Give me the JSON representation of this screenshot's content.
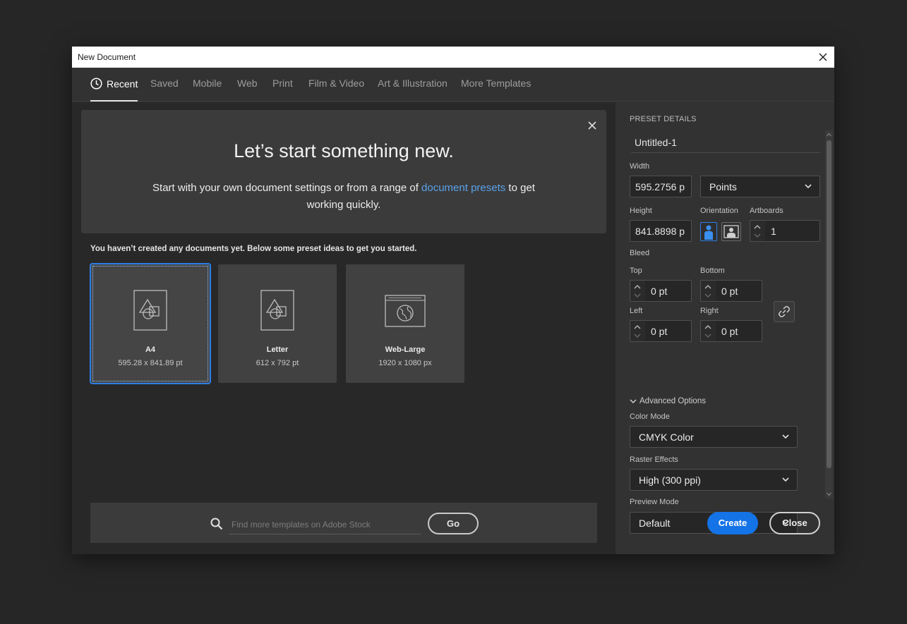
{
  "window": {
    "title": "New Document",
    "close_icon": "close-icon"
  },
  "tabs": [
    {
      "label": "Recent",
      "active": true,
      "icon": "clock-icon"
    },
    {
      "label": "Saved"
    },
    {
      "label": "Mobile"
    },
    {
      "label": "Web"
    },
    {
      "label": "Print"
    },
    {
      "label": "Film & Video"
    },
    {
      "label": "Art & Illustration"
    },
    {
      "label": "More Templates"
    }
  ],
  "hero": {
    "title": "Let’s start something new.",
    "text_before": "Start with your own document settings or from a range of ",
    "link": "document presets",
    "text_after": " to get working quickly."
  },
  "hint": "You haven’t created any documents yet. Below some preset ideas to get you started.",
  "presets": [
    {
      "name": "A4",
      "size": "595.28 x 841.89 pt",
      "selected": true,
      "icon": "page-shapes-icon"
    },
    {
      "name": "Letter",
      "size": "612 x 792 pt",
      "icon": "page-shapes-icon"
    },
    {
      "name": "Web-Large",
      "size": "1920 x 1080 px",
      "icon": "web-globe-icon"
    }
  ],
  "search": {
    "placeholder": "Find more templates on Adobe Stock",
    "go_label": "Go"
  },
  "details": {
    "header": "PRESET DETAILS",
    "doc_name": "Untitled-1",
    "width_label": "Width",
    "width_value": "595.2756 p",
    "units": "Points",
    "height_label": "Height",
    "height_value": "841.8898 p",
    "orientation_label": "Orientation",
    "artboards_label": "Artboards",
    "artboards_value": "1",
    "bleed_label": "Bleed",
    "top_label": "Top",
    "top_value": "0 pt",
    "bottom_label": "Bottom",
    "bottom_value": "0 pt",
    "left_label": "Left",
    "left_value": "0 pt",
    "right_label": "Right",
    "right_value": "0 pt",
    "advanced_label": "Advanced Options",
    "color_mode_label": "Color Mode",
    "color_mode_value": "CMYK Color",
    "raster_label": "Raster Effects",
    "raster_value": "High (300 ppi)",
    "preview_label": "Preview Mode",
    "preview_value": "Default",
    "create_label": "Create",
    "close_label": "Close"
  },
  "colors": {
    "accent": "#1473e6",
    "link": "#59a2ea",
    "selection": "#2d7ee6"
  }
}
